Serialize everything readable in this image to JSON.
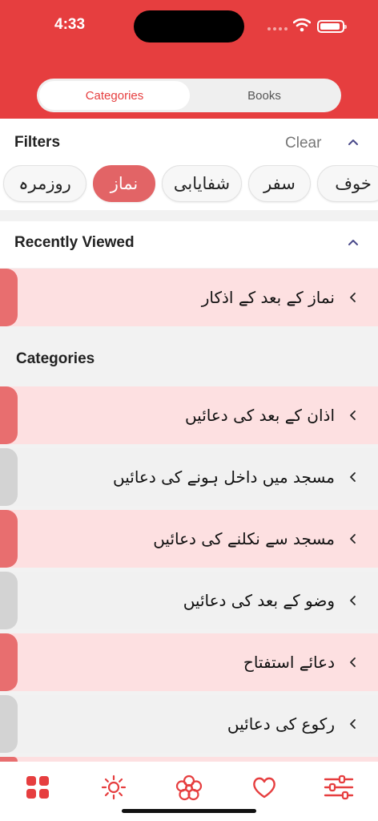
{
  "status_bar": {
    "time": "4:33"
  },
  "segmented": {
    "active": "Categories",
    "inactive": "Books"
  },
  "filters": {
    "title": "Filters",
    "clear_label": "Clear",
    "chips": [
      "روزمرہ",
      "نماز",
      "شفایابی",
      "سفر",
      "خوف"
    ],
    "selected": "نماز"
  },
  "recent": {
    "title": "Recently Viewed",
    "items": [
      {
        "label": "نماز کے بعد کے اذکار"
      }
    ]
  },
  "categories": {
    "title": "Categories",
    "items": [
      {
        "label": "اذان کے بعد کی دعائیں"
      },
      {
        "label": "مسجد میں داخل ہونے کی دعائیں"
      },
      {
        "label": "مسجد سے نکلنے کی دعائیں"
      },
      {
        "label": "وضو کے بعد کی دعائیں"
      },
      {
        "label": "دعائے استفتاح"
      },
      {
        "label": "رکوع کی دعائیں"
      }
    ]
  },
  "tab_bar": {
    "items": [
      "grid-icon",
      "sun-icon",
      "flower-icon",
      "heart-icon",
      "sliders-icon"
    ]
  },
  "colors": {
    "accent": "#e63e3f",
    "pink_row": "#fde0e1",
    "tab_red": "#e86e6f",
    "tab_grey": "#d3d3d3"
  }
}
